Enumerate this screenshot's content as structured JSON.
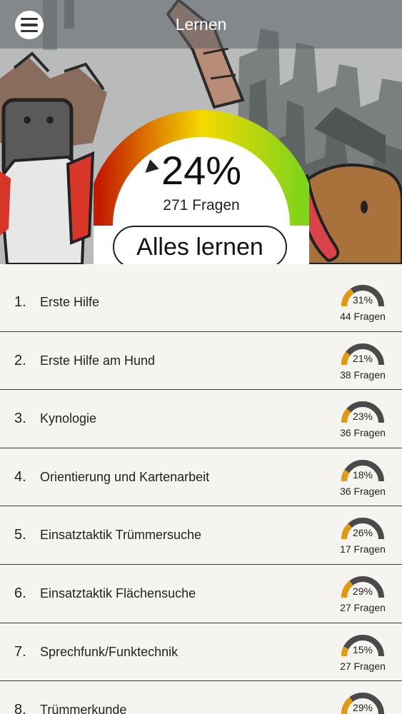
{
  "header": {
    "title": "Lernen"
  },
  "progress": {
    "percent_label": "24%",
    "percent": 24,
    "questions_label": "271 Fragen"
  },
  "learn_all_label": "Alles lernen",
  "colors": {
    "gauge_start": "#c41a00",
    "gauge_mid": "#f5d800",
    "gauge_end": "#7fd41c",
    "mini_track": "#4a4a4a",
    "mini_fill": "#e39a10"
  },
  "topics": [
    {
      "num": "1.",
      "label": "Erste Hilfe",
      "pct_label": "31%",
      "pct": 31,
      "questions": "44 Fragen"
    },
    {
      "num": "2.",
      "label": "Erste Hilfe am Hund",
      "pct_label": "21%",
      "pct": 21,
      "questions": "38 Fragen"
    },
    {
      "num": "3.",
      "label": "Kynologie",
      "pct_label": "23%",
      "pct": 23,
      "questions": "36 Fragen"
    },
    {
      "num": "4.",
      "label": "Orientierung und Kartenarbeit",
      "pct_label": "18%",
      "pct": 18,
      "questions": "36 Fragen"
    },
    {
      "num": "5.",
      "label": "Einsatztaktik Trümmersuche",
      "pct_label": "26%",
      "pct": 26,
      "questions": "17 Fragen"
    },
    {
      "num": "6.",
      "label": "Einsatztaktik Flächensuche",
      "pct_label": "29%",
      "pct": 29,
      "questions": "27 Fragen"
    },
    {
      "num": "7.",
      "label": "Sprechfunk/Funktechnik",
      "pct_label": "15%",
      "pct": 15,
      "questions": "27 Fragen"
    },
    {
      "num": "8.",
      "label": "Trümmerkunde",
      "pct_label": "29%",
      "pct": 29,
      "questions": ""
    }
  ]
}
